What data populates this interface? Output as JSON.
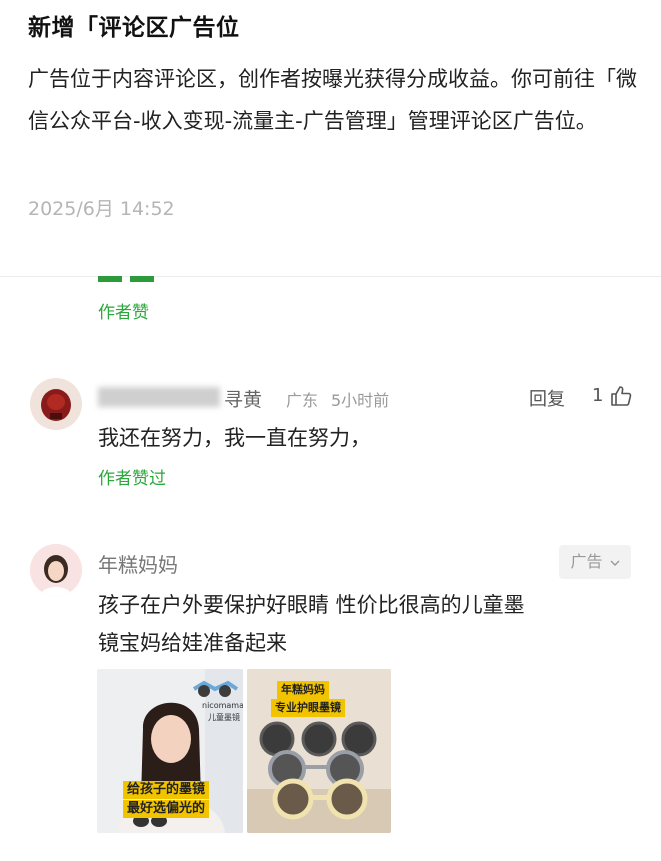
{
  "notice": {
    "title": "新增「评论区广告位",
    "body": "广告位于内容评论区，创作者按曝光获得分成收益。你可前往「微信公众平台-收入变现-流量主-广告管理」管理评论区广告位。",
    "time": "2025/6月 14:52"
  },
  "comments": [
    {
      "author_tag": "作者赞"
    },
    {
      "name_suffix": "寻黄",
      "location": "广东",
      "time_ago": "5小时前",
      "reply_label": "回复",
      "like_count": "1",
      "text": "我还在努力，我一直在努力，",
      "author_tag": "作者赞过"
    }
  ],
  "ad": {
    "name": "年糕妈妈",
    "badge": "广告",
    "text_line1": "孩子在户外要保护好眼睛 性价比很高的儿童墨",
    "text_line2": "镜宝妈给娃准备起来",
    "image1": {
      "brand": "nicomama",
      "brand_sub": "儿童墨镜",
      "caption_line1": "给孩子的墨镜",
      "caption_line2": "最好选偏光的"
    },
    "image2": {
      "tag_line1": "年糕妈妈",
      "tag_line2": "专业护眼墨镜"
    }
  },
  "colors": {
    "accent_green": "#2aa83a",
    "muted": "#9a9a9a",
    "badge_bg": "#f2f2f2"
  }
}
